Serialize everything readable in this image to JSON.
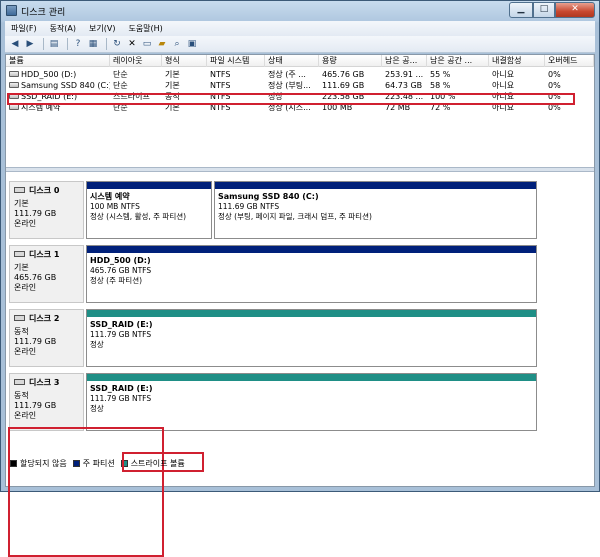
{
  "window": {
    "title": "디스크 관리"
  },
  "window_controls": {
    "minimize": "▁",
    "maximize": "□",
    "close": "✕"
  },
  "menu": [
    "파일(F)",
    "동작(A)",
    "보기(V)",
    "도움말(H)"
  ],
  "toolbar_icons": [
    "back-arrow-icon",
    "forward-arrow-icon",
    "console-tree-icon",
    "help-icon",
    "properties-icon",
    "refresh-icon",
    "delete-icon",
    "new-disk-icon",
    "open-folder-icon",
    "search-icon",
    "settings-icon"
  ],
  "volume_list": {
    "columns": [
      "볼륨",
      "레이아웃",
      "형식",
      "파일 시스템",
      "상태",
      "용량",
      "남은 공...",
      "남은 공간 ...",
      "내결함성",
      "오버헤드"
    ],
    "rows": [
      [
        "HDD_500 (D:)",
        "단순",
        "기본",
        "NTFS",
        "정상 (주 ...",
        "465.76 GB",
        "253.91 ...",
        "55 %",
        "아니요",
        "0%"
      ],
      [
        "Samsung SSD 840 (C:)",
        "단순",
        "기본",
        "NTFS",
        "정상 (부팅...",
        "111.69 GB",
        "64.73 GB",
        "58 %",
        "아니요",
        "0%"
      ],
      [
        "SSD_RAID (E:)",
        "스트라이프",
        "동적",
        "NTFS",
        "정상",
        "223.58 GB",
        "223.48 ...",
        "100 %",
        "아니요",
        "0%"
      ],
      [
        "시스템 예약",
        "단순",
        "기본",
        "NTFS",
        "정상 (시스...",
        "100 MB",
        "72 MB",
        "72 %",
        "아니요",
        "0%"
      ]
    ]
  },
  "disks": [
    {
      "name": "디스크 0",
      "type": "기본",
      "size": "111.79 GB",
      "status": "온라인",
      "partitions": [
        {
          "name": "시스템 예약",
          "size": "100 MB NTFS",
          "status": "정상 (시스템, 활성, 주 파티션)"
        },
        {
          "name": "Samsung SSD 840  (C:)",
          "size": "111.69 GB NTFS",
          "status": "정상 (부팅, 페이지 파일, 크래시 덤프, 주 파티션)"
        }
      ]
    },
    {
      "name": "디스크 1",
      "type": "기본",
      "size": "465.76 GB",
      "status": "온라인",
      "partitions": [
        {
          "name": "HDD_500  (D:)",
          "size": "465.76 GB NTFS",
          "status": "정상 (주 파티션)"
        }
      ]
    },
    {
      "name": "디스크 2",
      "type": "동적",
      "size": "111.79 GB",
      "status": "온라인",
      "partitions": [
        {
          "name": "SSD_RAID  (E:)",
          "size": "111.79 GB NTFS",
          "status": "정상"
        }
      ]
    },
    {
      "name": "디스크 3",
      "type": "동적",
      "size": "111.79 GB",
      "status": "온라인",
      "partitions": [
        {
          "name": "SSD_RAID  (E:)",
          "size": "111.79 GB NTFS",
          "status": "정상"
        }
      ]
    }
  ],
  "legend": [
    {
      "label": "할당되지 않음",
      "color": "#000000"
    },
    {
      "label": "주 파티션",
      "color": "#00207a"
    },
    {
      "label": "스트라이프 볼륨",
      "color": "#1f8f86"
    }
  ],
  "colors": {
    "primary_partition": "#00207a",
    "striped_volume": "#1f8f86",
    "highlight": "#d02030"
  }
}
